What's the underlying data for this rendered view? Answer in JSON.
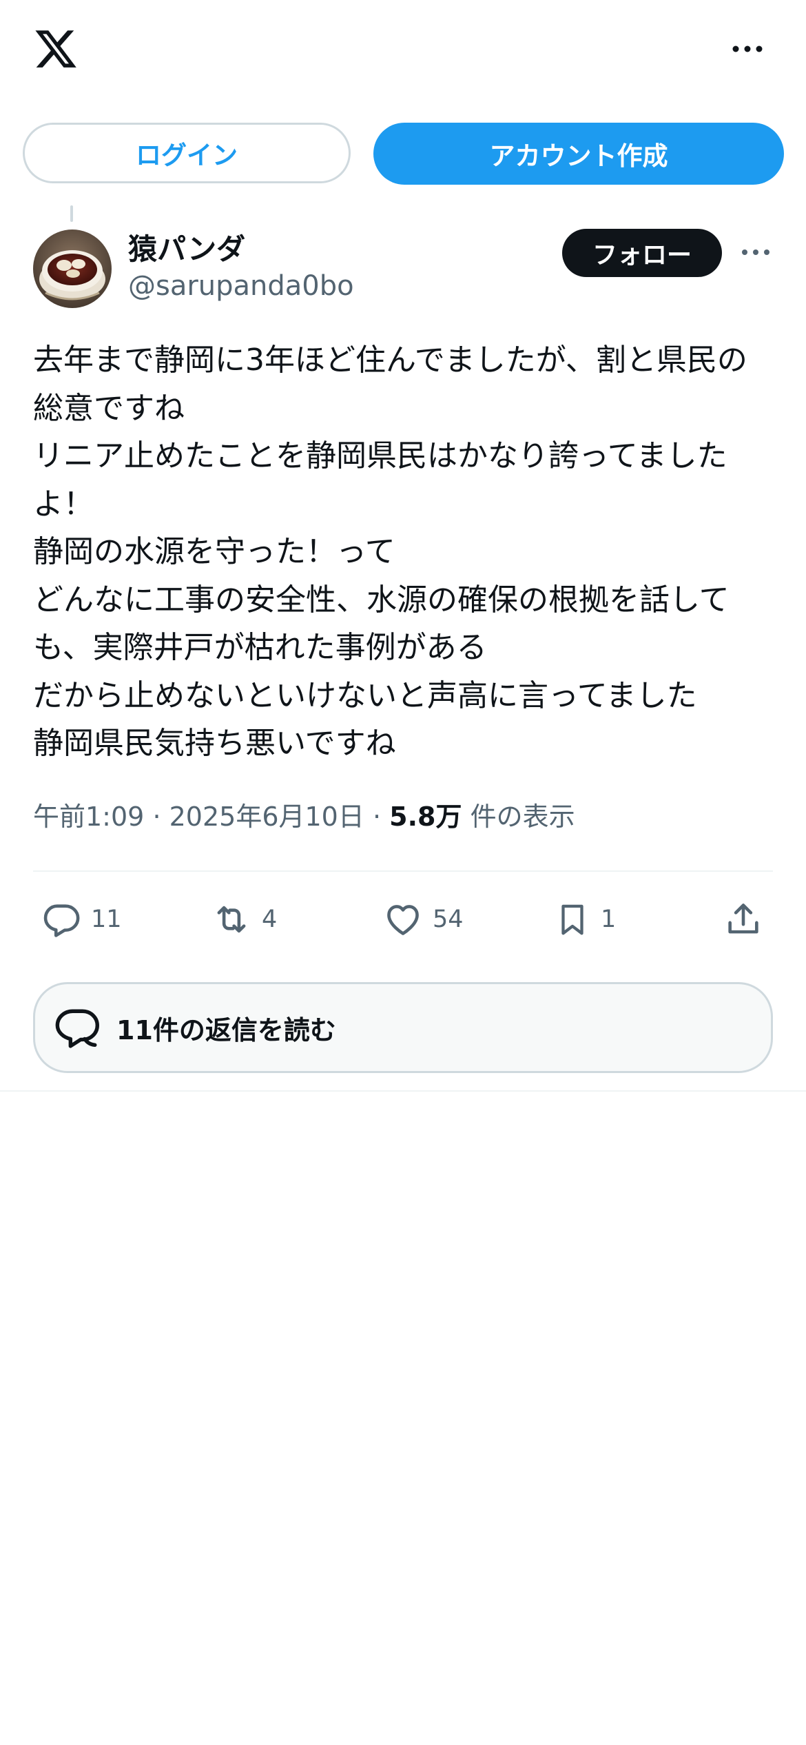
{
  "header": {
    "logo_icon": "x-logo-icon",
    "more_icon": "more-horizontal-icon"
  },
  "auth": {
    "login_label": "ログイン",
    "signup_label": "アカウント作成"
  },
  "post": {
    "author": {
      "name": "猿パンダ",
      "handle": "@sarupanda0bo"
    },
    "follow_label": "フォロー",
    "text": "去年まで静岡に3年ほど住んでましたが、割と県民の総意ですね\nリニア止めたことを静岡県民はかなり誇ってましたよ！\n静岡の水源を守った！って\nどんなに工事の安全性、水源の確保の根拠を話しても、実際井戸が枯れた事例がある\nだから止めないといけないと声高に言ってました\n静岡県民気持ち悪いですね",
    "meta": {
      "time": "午前1:09",
      "date": "2025年6月10日",
      "sep": "·",
      "views_count": "5.8万",
      "views_label": "件の表示"
    },
    "actions": {
      "replies": "11",
      "reposts": "4",
      "likes": "54",
      "bookmarks": "1"
    },
    "read_replies_label": "11件の返信を読む"
  },
  "colors": {
    "accent": "#1d9bf0",
    "text_primary": "#0f1419",
    "text_secondary": "#536471",
    "border": "#cfd9de"
  }
}
